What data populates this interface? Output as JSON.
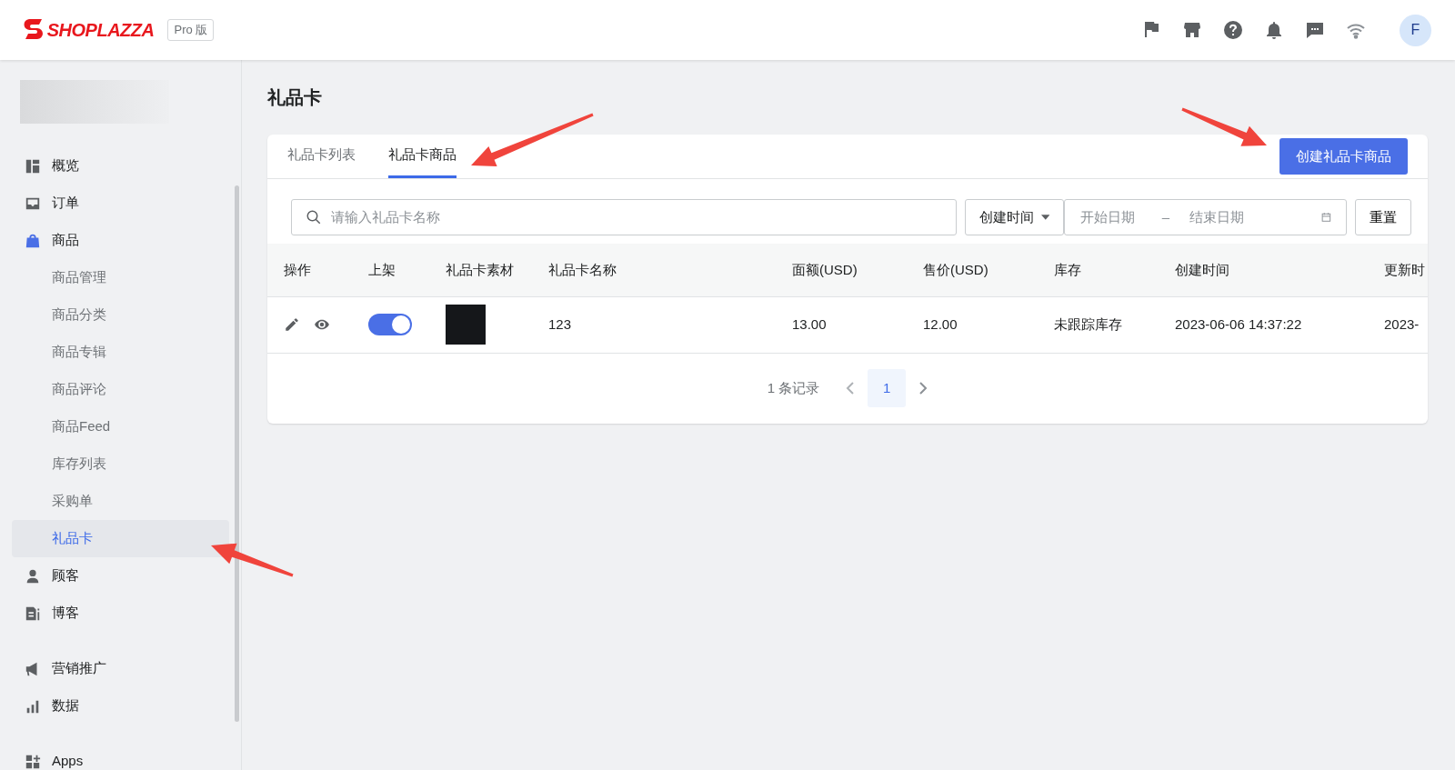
{
  "header": {
    "logo": "SHOPLAZZA",
    "plan_badge": "Pro 版",
    "avatar": "F"
  },
  "sidebar": {
    "sections": [
      [
        {
          "label": "概览",
          "active": false
        },
        {
          "label": "订单",
          "active": false
        },
        {
          "label": "商品",
          "active": true,
          "children": [
            {
              "label": "商品管理",
              "selected": false
            },
            {
              "label": "商品分类",
              "selected": false
            },
            {
              "label": "商品专辑",
              "selected": false
            },
            {
              "label": "商品评论",
              "selected": false
            },
            {
              "label": "商品Feed",
              "selected": false
            },
            {
              "label": "库存列表",
              "selected": false
            },
            {
              "label": "采购单",
              "selected": false
            },
            {
              "label": "礼品卡",
              "selected": true
            }
          ]
        },
        {
          "label": "顾客",
          "active": false
        },
        {
          "label": "博客",
          "active": false
        }
      ],
      [
        {
          "label": "营销推广",
          "active": false
        },
        {
          "label": "数据",
          "active": false
        }
      ],
      [
        {
          "label": "Apps",
          "active": false
        }
      ]
    ]
  },
  "page_title": "礼品卡",
  "tabs": [
    {
      "label": "礼品卡列表",
      "selected": false
    },
    {
      "label": "礼品卡商品",
      "selected": true
    }
  ],
  "create_button": "创建礼品卡商品",
  "filters": {
    "search": {
      "placeholder": "请输入礼品卡名称"
    },
    "date_type": "创建时间",
    "start_date": {
      "placeholder": "开始日期"
    },
    "separator": "–",
    "end_date": {
      "placeholder": "结束日期"
    },
    "reset": "重置"
  },
  "table": {
    "columns": [
      "操作",
      "上架",
      "礼品卡素材",
      "礼品卡名称",
      "面额(USD)",
      "售价(USD)",
      "库存",
      "创建时间",
      "更新时"
    ],
    "rows": [
      {
        "on": true,
        "name": "123",
        "face_value": "13.00",
        "price": "12.00",
        "stock": "未跟踪库存",
        "created": "2023-06-06 14:37:22",
        "updated": "2023-"
      }
    ]
  },
  "pagination": {
    "total": "1 条记录",
    "pages": [
      {
        "label": "1",
        "selected": true
      }
    ]
  }
}
